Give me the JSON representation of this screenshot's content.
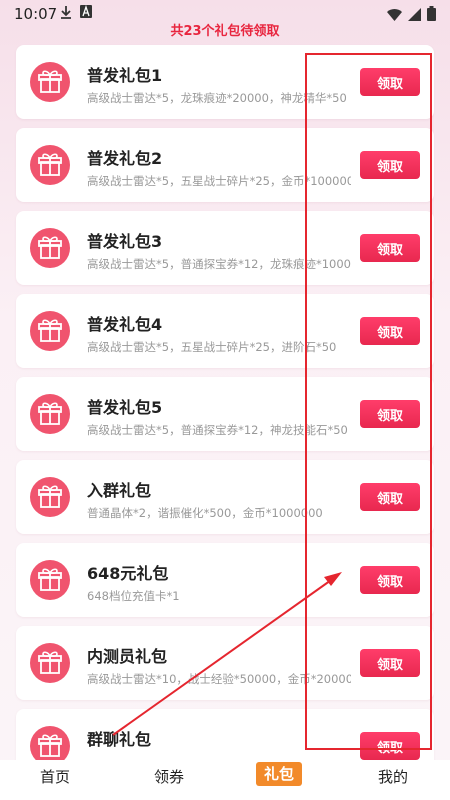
{
  "status_bar": {
    "time": "10:07",
    "icons": [
      "download-icon",
      "a-badge-icon",
      "wifi-icon",
      "signal-icon",
      "battery-icon"
    ]
  },
  "notice": "共23个礼包待领取",
  "claim_label": "领取",
  "gifts": [
    {
      "title": "普发礼包1",
      "desc": "高级战士雷达*5，龙珠痕迹*20000，神龙精华*50"
    },
    {
      "title": "普发礼包2",
      "desc": "高级战士雷达*5，五星战士碎片*25，金币*1000000"
    },
    {
      "title": "普发礼包3",
      "desc": "高级战士雷达*5，普通探宝券*12，龙珠痕迹*10000"
    },
    {
      "title": "普发礼包4",
      "desc": "高级战士雷达*5，五星战士碎片*25，进阶石*50"
    },
    {
      "title": "普发礼包5",
      "desc": "高级战士雷达*5，普通探宝券*12，神龙技能石*50"
    },
    {
      "title": "入群礼包",
      "desc": "普通晶体*2，谐振催化*500，金币*1000000"
    },
    {
      "title": "648元礼包",
      "desc": "648档位充值卡*1"
    },
    {
      "title": "内测员礼包",
      "desc": "高级战士雷达*10，战士经验*50000，金币*2000000"
    },
    {
      "title": "群聊礼包",
      "desc": ""
    }
  ],
  "tabs": [
    {
      "label": "首页",
      "active": false
    },
    {
      "label": "领券",
      "active": false
    },
    {
      "label": "礼包",
      "active": true
    },
    {
      "label": "我的",
      "active": false
    }
  ],
  "colors": {
    "accent": "#e8284f",
    "icon_bg": "#f0546e",
    "annotation": "#e5262f",
    "active_tab": "#f28a2a"
  }
}
